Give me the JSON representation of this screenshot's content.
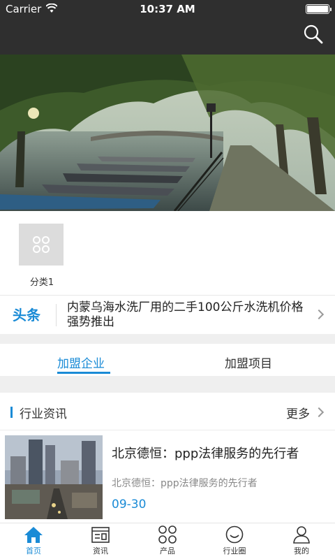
{
  "status_bar": {
    "carrier": "Carrier",
    "time": "10:37 AM"
  },
  "header": {
    "search_icon": "search-icon"
  },
  "categories": [
    {
      "label": "分类1",
      "icon": "grid-icon"
    }
  ],
  "headline": {
    "badge": "头条",
    "text": "内蒙乌海水洗厂用的二手100公斤水洗机价格强势推出"
  },
  "join_tabs": [
    {
      "label": "加盟企业",
      "active": true
    },
    {
      "label": "加盟项目",
      "active": false
    }
  ],
  "news": {
    "title": "行业资讯",
    "more": "更多",
    "articles": [
      {
        "title": "北京德恒：ppp法律服务的先行者",
        "desc": "北京德恒：ppp法律服务的先行者",
        "date": "09-30"
      }
    ]
  },
  "tabbar": [
    {
      "label": "首页",
      "icon": "home-icon",
      "active": true
    },
    {
      "label": "资讯",
      "icon": "news-icon",
      "active": false
    },
    {
      "label": "产品",
      "icon": "products-icon",
      "active": false
    },
    {
      "label": "行业圈",
      "icon": "circle-icon",
      "active": false
    },
    {
      "label": "我的",
      "icon": "user-icon",
      "active": false
    }
  ],
  "colors": {
    "accent": "#1a8bd6",
    "header": "#2f2f2f"
  }
}
